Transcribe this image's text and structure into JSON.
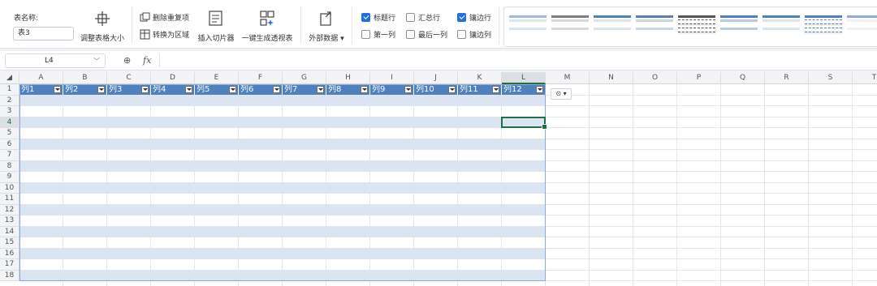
{
  "ribbon": {
    "table_name_label": "表名称:",
    "table_name_value": "表3",
    "resize_label": "调整表格大小",
    "remove_dup_label": "删除重复项",
    "to_range_label": "转换为区域",
    "slicer_label": "插入切片器",
    "pivot_label": "一键生成透视表",
    "external_label": "外部数据",
    "checkboxes": {
      "header_row": "标题行",
      "total_row": "汇总行",
      "banded_rows": "镶边行",
      "first_col": "第一列",
      "last_col": "最后一列",
      "banded_cols": "镶边列"
    },
    "checkbox_state": {
      "header_row": true,
      "total_row": false,
      "banded_rows": true,
      "first_col": false,
      "last_col": false,
      "banded_cols": false
    }
  },
  "formula_bar": {
    "cell_ref": "L4",
    "fx_symbol": "fx",
    "formula": ""
  },
  "sheet": {
    "columns": [
      "A",
      "B",
      "C",
      "D",
      "E",
      "F",
      "G",
      "H",
      "I",
      "J",
      "K",
      "L",
      "M",
      "N",
      "O",
      "P",
      "Q",
      "R",
      "S",
      "T"
    ],
    "rows": [
      "1",
      "2",
      "3",
      "4",
      "5",
      "6",
      "7",
      "8",
      "9",
      "10",
      "11",
      "12",
      "13",
      "14",
      "15",
      "16",
      "17",
      "18"
    ],
    "active_column": "L",
    "active_row": "4",
    "table_headers": [
      "列1",
      "列2",
      "列3",
      "列4",
      "列5",
      "列6",
      "列7",
      "列8",
      "列9",
      "列10",
      "列11",
      "列12"
    ]
  },
  "colors": {
    "header_fill": "#4e81bd",
    "band_fill": "#dbe5f1",
    "select_border": "#1e7145"
  }
}
